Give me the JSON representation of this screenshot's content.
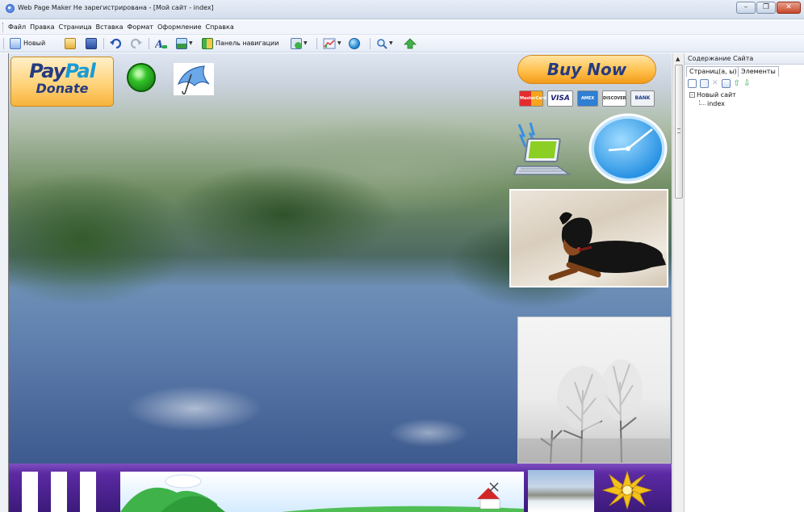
{
  "window": {
    "title": "Web Page Maker Не зарегистрирована - [Мой сайт - index]",
    "controls": {
      "minimize": "–",
      "restore": "❐",
      "close": "✕"
    }
  },
  "menu": [
    "Файл",
    "Правка",
    "Страница",
    "Вставка",
    "Формат",
    "Оформление",
    "Справка"
  ],
  "toolbar": {
    "new_label": "Новый",
    "nav_panel_label": "Панель навигации"
  },
  "canvas": {
    "paypal": {
      "brand_pay": "Pay",
      "brand_pal": "Pal",
      "donate": "Donate"
    },
    "buy_now": "Buy Now",
    "cards": [
      "MasterCard",
      "VISA",
      "AMEX",
      "DISCOVER",
      "BANK"
    ]
  },
  "right_panel": {
    "title": "Содержание Сайта",
    "tabs": [
      "Страниц(а, ы)",
      "Элементы"
    ],
    "tree": {
      "root": "Новый сайт",
      "child": "index",
      "expander": "–"
    }
  },
  "scrollbar": {
    "up_arrow": "▲"
  },
  "colors": {
    "titlebar": "#d3ddec",
    "bottom_bar": "#5c2aa3",
    "paypal_navy": "#253b80",
    "paypal_blue": "#179bd7",
    "button_orange": "#ffc04d"
  }
}
